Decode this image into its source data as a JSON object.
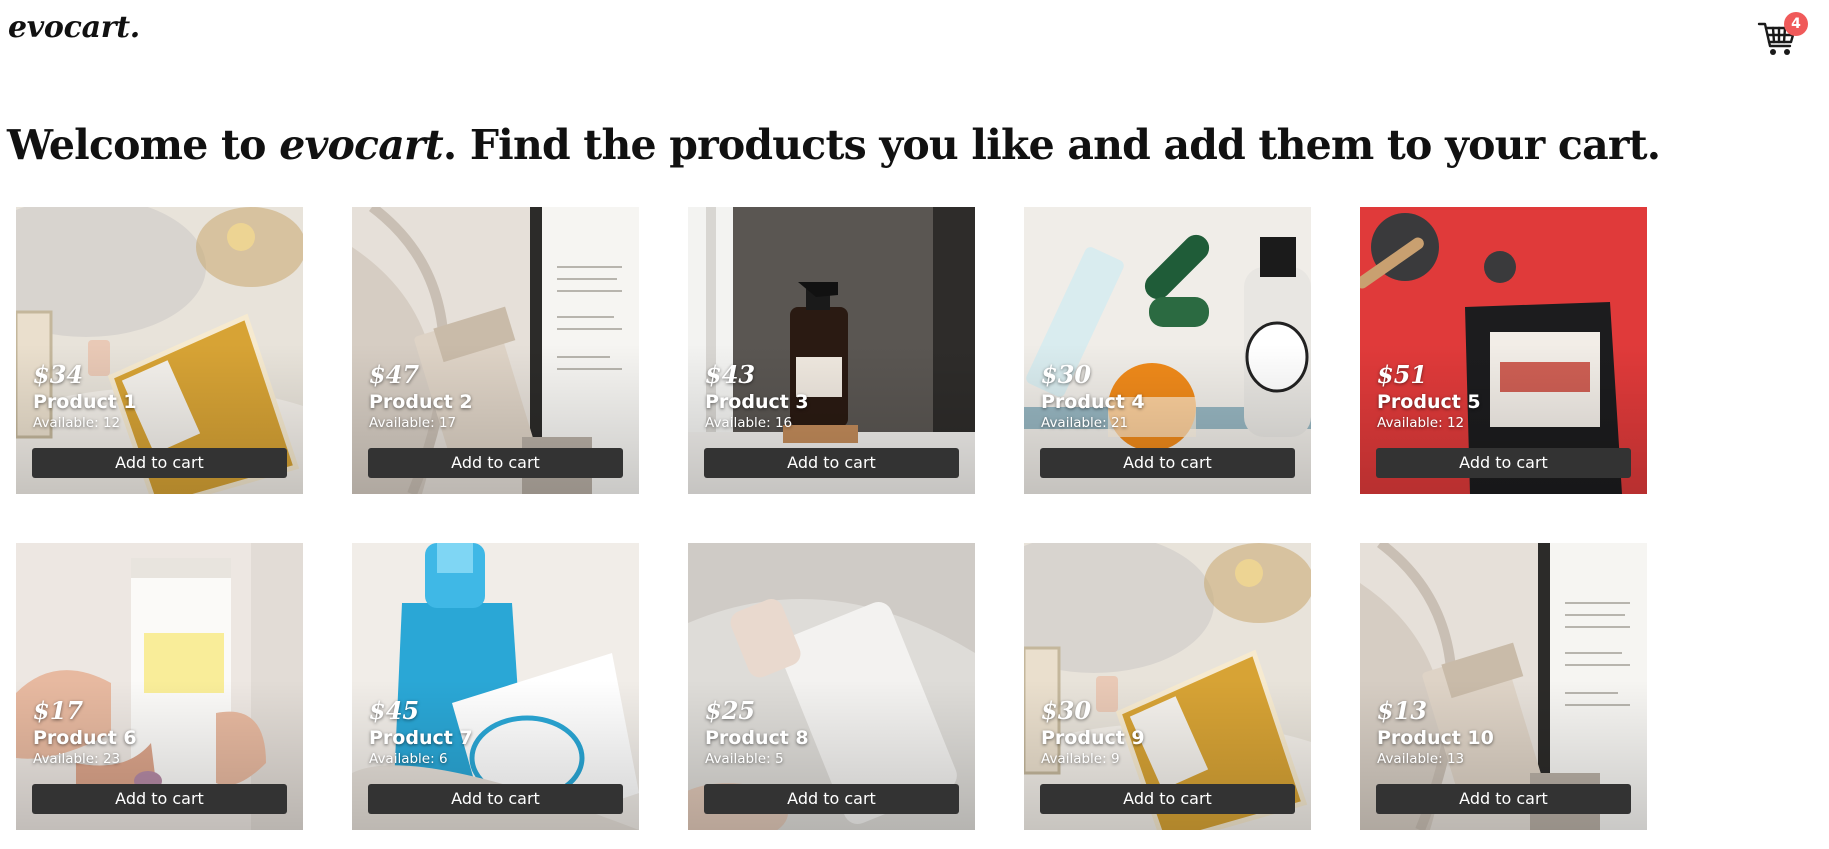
{
  "header": {
    "logo": "evocart.",
    "cart_count": "4",
    "cart_icon": "shopping-cart-icon"
  },
  "headline": {
    "prefix": "Welcome to ",
    "brand": "evocart",
    "suffix": ". Find the products you like and add them to your cart."
  },
  "colors": {
    "button_bg": "#333333",
    "badge_bg": "#f05a5a",
    "text": "#111111"
  },
  "products": [
    {
      "price": "$34",
      "name": "Product 1",
      "available": "Available: 12",
      "button": "Add to cart",
      "image": "perfume-bottle-photo"
    },
    {
      "price": "$47",
      "name": "Product 2",
      "available": "Available: 17",
      "button": "Add to cart",
      "image": "skincare-tube-book-photo"
    },
    {
      "price": "$43",
      "name": "Product 3",
      "available": "Available: 16",
      "button": "Add to cart",
      "image": "spray-bottle-window-photo"
    },
    {
      "price": "$30",
      "name": "Product 4",
      "available": "Available: 21",
      "button": "Add to cart",
      "image": "skincare-flatlay-photo"
    },
    {
      "price": "$51",
      "name": "Product 5",
      "available": "Available: 12",
      "button": "Add to cart",
      "image": "charcoal-pouch-red-photo"
    },
    {
      "price": "$17",
      "name": "Product 6",
      "available": "Available: 23",
      "button": "Add to cart",
      "image": "hand-holding-tube-photo"
    },
    {
      "price": "$45",
      "name": "Product 7",
      "available": "Available: 6",
      "button": "Add to cart",
      "image": "micellar-water-bottle-photo"
    },
    {
      "price": "$25",
      "name": "Product 8",
      "available": "Available: 5",
      "button": "Add to cart",
      "image": "serum-bottle-marble-photo"
    },
    {
      "price": "$30",
      "name": "Product 9",
      "available": "Available: 9",
      "button": "Add to cart",
      "image": "perfume-bottle-photo"
    },
    {
      "price": "$13",
      "name": "Product 10",
      "available": "Available: 13",
      "button": "Add to cart",
      "image": "skincare-tube-book-photo"
    }
  ]
}
